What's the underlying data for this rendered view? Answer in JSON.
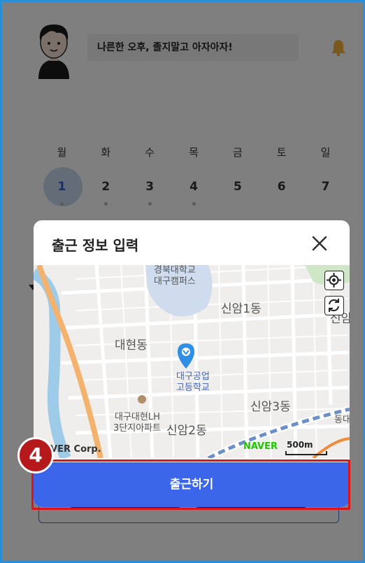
{
  "header": {
    "greeting": "나른한 오후, 졸지말고 아자아자!",
    "avatar_icon": "avatar-icon",
    "notification_icon": "bell-icon",
    "notification_color": "#f2b33a"
  },
  "calendar": {
    "weekdays": [
      "월",
      "화",
      "수",
      "목",
      "금",
      "토",
      "일"
    ],
    "dates": [
      "1",
      "2",
      "3",
      "4",
      "5",
      "6",
      "7"
    ],
    "selected_date": "1"
  },
  "modal": {
    "title": "출근 정보 입력",
    "close_icon": "close-icon",
    "map": {
      "labels": {
        "university": "경북대학교",
        "campus": "대구캠퍼스",
        "sinam1": "신암1동",
        "sinam_partial": "신암",
        "daehyeon": "대현동",
        "school_line1": "대구공업",
        "school_line2": "고등학교",
        "apartment_line1": "대구대현LH",
        "apartment_line2": "3단지아파트",
        "sinam2": "신암2동",
        "sinam3": "신암3동",
        "dong": "동대"
      },
      "locate_icon": "locate-icon",
      "refresh_icon": "refresh-icon",
      "attribution": "NAVER Corp.",
      "logo": "NAVER",
      "scale_label": "500m"
    },
    "submit_button": "출근하기",
    "accent_color": "#3b66ea"
  },
  "annotation": {
    "step_number": "4",
    "color": "#d9171b"
  }
}
